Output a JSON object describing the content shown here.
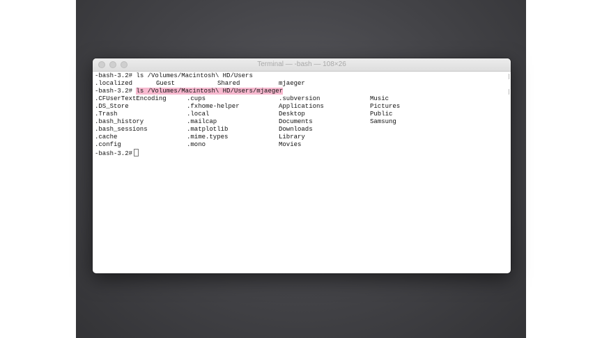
{
  "window": {
    "title": "Terminal — -bash — 108×26"
  },
  "terminal": {
    "prompt": "-bash-3.2#",
    "command1": "ls /Volumes/Macintosh\\ HD/Users",
    "users_listing": [
      ".localized",
      "Guest",
      "Shared",
      "mjaeger"
    ],
    "command2": "ls /Volumes/Macintosh\\ HD/Users/mjaeger",
    "columns": [
      [
        ".CFUserTextEncoding",
        ".DS_Store",
        ".Trash",
        ".bash_history",
        ".bash_sessions",
        ".cache",
        ".config"
      ],
      [
        ".cups",
        ".fxhome-helper",
        ".local",
        ".mailcap",
        ".matplotlib",
        ".mime.types",
        ".mono"
      ],
      [
        ".subversion",
        "Applications",
        "Desktop",
        "Documents",
        "Downloads",
        "Library",
        "Movies"
      ],
      [
        "Music",
        "Pictures",
        "Public",
        "Samsung"
      ]
    ]
  },
  "colors": {
    "highlight": "#f7b9cf",
    "desktop": "#434347"
  }
}
